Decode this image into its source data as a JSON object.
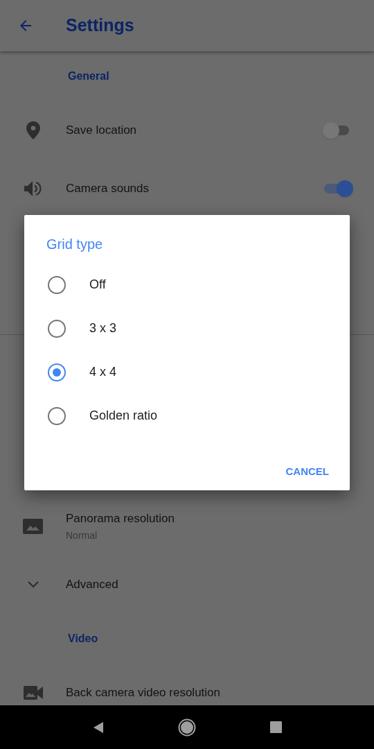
{
  "header": {
    "title": "Settings"
  },
  "settings_above": [
    {
      "kind": "section",
      "label": "General"
    },
    {
      "kind": "toggle",
      "label": "Save location",
      "on": false
    },
    {
      "kind": "toggle",
      "label": "Camera sounds",
      "on": true
    }
  ],
  "settings_below": [
    {
      "kind": "value",
      "label": "Panorama resolution",
      "value": "Normal"
    },
    {
      "kind": "expander",
      "label": "Advanced"
    },
    {
      "kind": "section",
      "label": "Video"
    },
    {
      "kind": "value",
      "label": "Back camera video resolution"
    }
  ],
  "dialog": {
    "title": "Grid type",
    "options": [
      {
        "label": "Off",
        "selected": false
      },
      {
        "label": "3 x 3",
        "selected": false
      },
      {
        "label": "4 x 4",
        "selected": true
      },
      {
        "label": "Golden ratio",
        "selected": false
      }
    ],
    "buttons": [
      "CANCEL"
    ]
  }
}
